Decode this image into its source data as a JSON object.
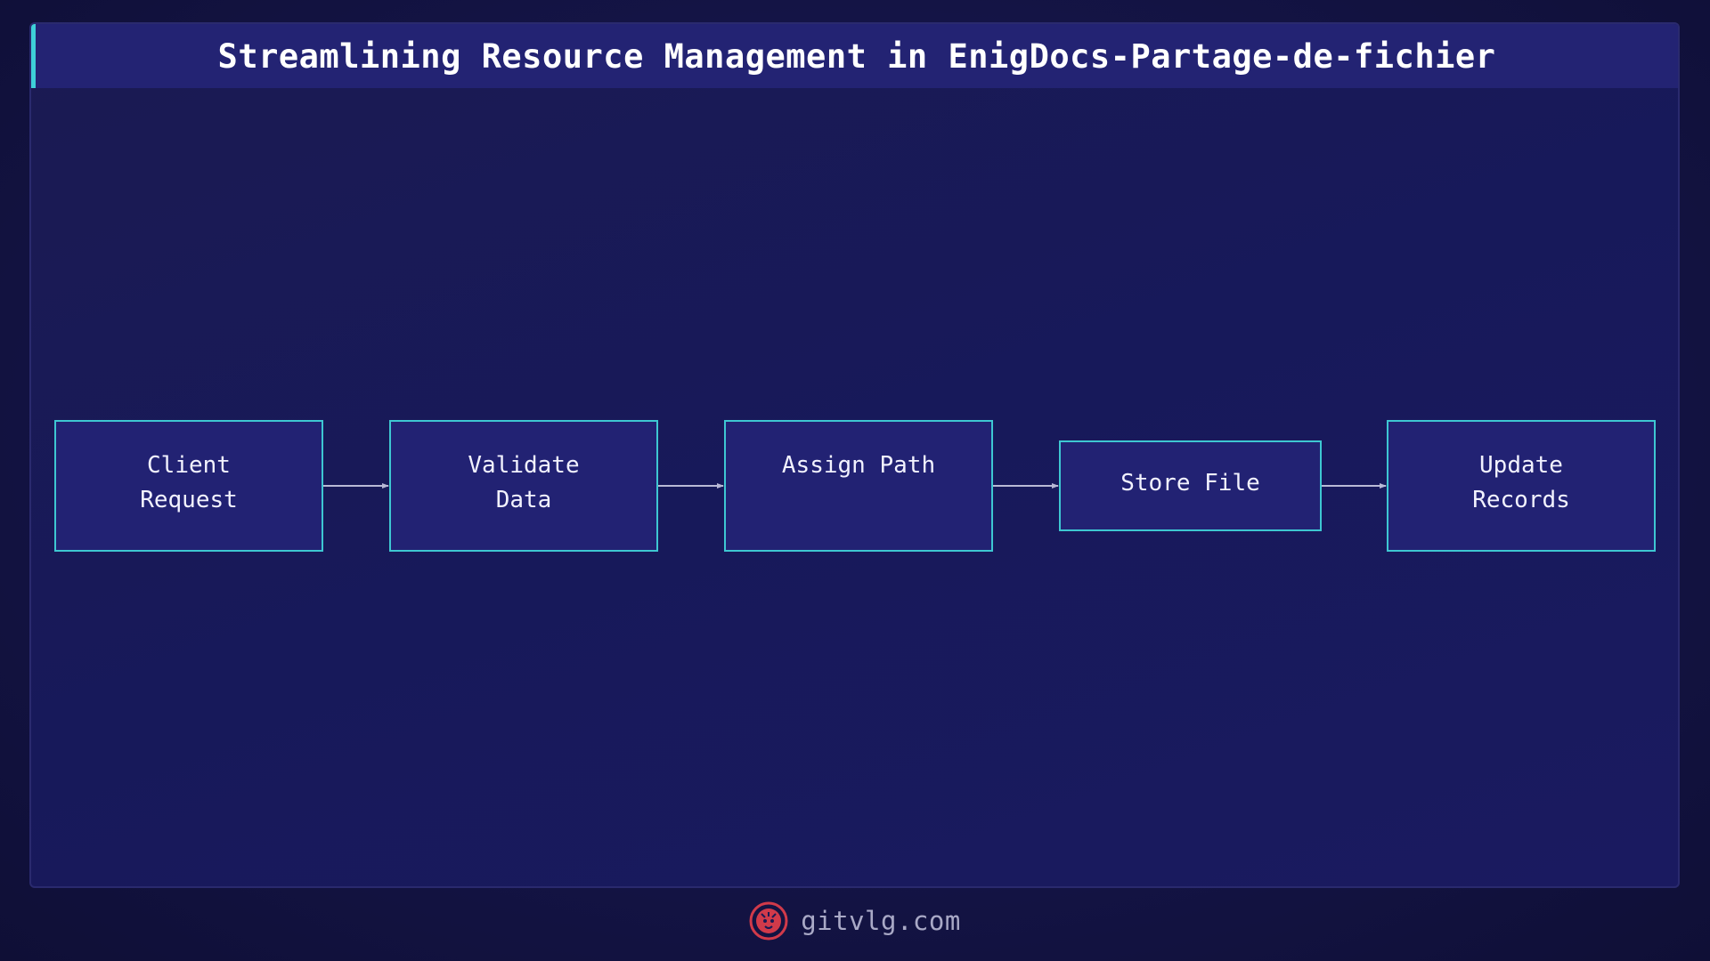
{
  "title": "Streamlining Resource Management in EnigDocs-Partage-de-fichier",
  "nodes": [
    {
      "id": "client-request",
      "label": "Client\nRequest"
    },
    {
      "id": "validate-data",
      "label": "Validate\nData"
    },
    {
      "id": "assign-path",
      "label": "Assign Path"
    },
    {
      "id": "store-file",
      "label": "Store File"
    },
    {
      "id": "update-records",
      "label": "Update\nRecords"
    }
  ],
  "edges": [
    {
      "from": "client-request",
      "to": "validate-data"
    },
    {
      "from": "validate-data",
      "to": "assign-path"
    },
    {
      "from": "assign-path",
      "to": "store-file"
    },
    {
      "from": "store-file",
      "to": "update-records"
    }
  ],
  "colors": {
    "node_fill": "#222273",
    "node_border": "#3ec7d2",
    "arrow": "#b9b9d6",
    "accent": "#3ed0d8",
    "logo": "#d13a4a"
  },
  "footer": {
    "logo_icon": "lion-head-icon",
    "text": "gitvlg.com"
  }
}
